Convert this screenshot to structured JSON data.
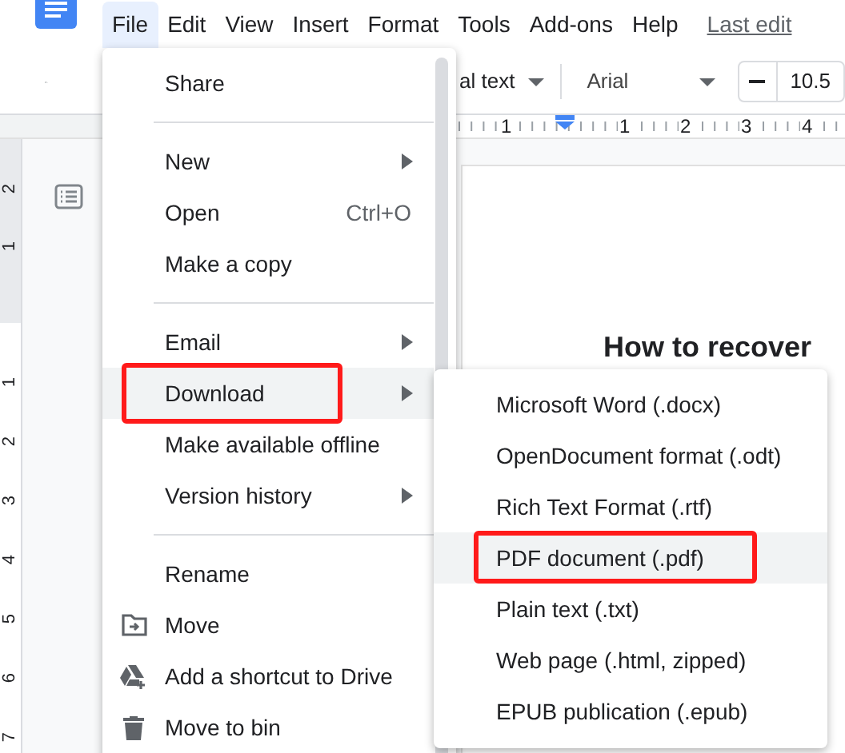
{
  "menubar": {
    "items": [
      {
        "label": "File",
        "selected": true
      },
      {
        "label": "Edit",
        "selected": false
      },
      {
        "label": "View",
        "selected": false
      },
      {
        "label": "Insert",
        "selected": false
      },
      {
        "label": "Format",
        "selected": false
      },
      {
        "label": "Tools",
        "selected": false
      },
      {
        "label": "Add-ons",
        "selected": false
      },
      {
        "label": "Help",
        "selected": false
      }
    ],
    "last_edit": "Last edit"
  },
  "toolbar": {
    "style_dropdown": "al text",
    "font_dropdown": "Arial",
    "font_size": "10.5"
  },
  "ruler": {
    "horizontal": [
      "1",
      "1",
      "2",
      "3",
      "4"
    ],
    "vertical": [
      "2",
      "1",
      "1",
      "2",
      "3",
      "4",
      "5",
      "6",
      "7"
    ]
  },
  "document": {
    "title": "How to recover"
  },
  "file_menu": {
    "items": [
      {
        "kind": "item",
        "label": "Share",
        "submenu": false,
        "selected": false,
        "outlined": false
      },
      {
        "kind": "separator"
      },
      {
        "kind": "item",
        "label": "New",
        "submenu": true,
        "selected": false,
        "outlined": false
      },
      {
        "kind": "item",
        "label": "Open",
        "shortcut": "Ctrl+O",
        "submenu": false,
        "selected": false,
        "outlined": false
      },
      {
        "kind": "item",
        "label": "Make a copy",
        "submenu": false,
        "selected": false,
        "outlined": false
      },
      {
        "kind": "separator"
      },
      {
        "kind": "item",
        "label": "Email",
        "submenu": true,
        "selected": false,
        "outlined": false
      },
      {
        "kind": "item",
        "label": "Download",
        "submenu": true,
        "selected": true,
        "outlined": true
      },
      {
        "kind": "item",
        "label": "Make available offline",
        "submenu": false,
        "selected": false,
        "outlined": false
      },
      {
        "kind": "item",
        "label": "Version history",
        "submenu": true,
        "selected": false,
        "outlined": false
      },
      {
        "kind": "separator"
      },
      {
        "kind": "item",
        "label": "Rename",
        "submenu": false,
        "selected": false,
        "outlined": false
      },
      {
        "kind": "folder-item",
        "label": "Move",
        "submenu": false,
        "selected": false,
        "outlined": false
      },
      {
        "kind": "drive-item",
        "label": "Add a shortcut to Drive",
        "submenu": false,
        "selected": false,
        "outlined": false
      },
      {
        "kind": "bin-item",
        "label": "Move to bin",
        "submenu": false,
        "selected": false,
        "outlined": false
      }
    ]
  },
  "download_menu": {
    "items": [
      {
        "label": "Microsoft Word (.docx)",
        "selected": false,
        "outlined": false
      },
      {
        "label": "OpenDocument format (.odt)",
        "selected": false,
        "outlined": false
      },
      {
        "label": "Rich Text Format (.rtf)",
        "selected": false,
        "outlined": false
      },
      {
        "label": "PDF document (.pdf)",
        "selected": true,
        "outlined": true
      },
      {
        "label": "Plain text (.txt)",
        "selected": false,
        "outlined": false
      },
      {
        "label": "Web page (.html, zipped)",
        "selected": false,
        "outlined": false
      },
      {
        "label": "EPUB publication (.epub)",
        "selected": false,
        "outlined": false
      }
    ]
  }
}
